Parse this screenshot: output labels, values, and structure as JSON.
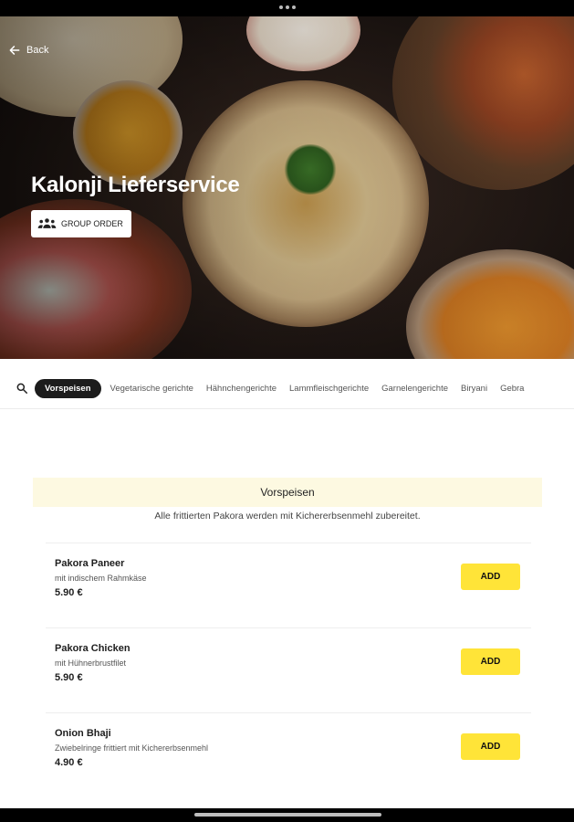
{
  "header": {
    "back_label": "Back"
  },
  "restaurant": {
    "name": "Kalonji Lieferservice",
    "group_order_label": "GROUP ORDER"
  },
  "categories": [
    {
      "label": "Vorspeisen",
      "active": true
    },
    {
      "label": "Vegetarische gerichte"
    },
    {
      "label": "Hähnchengerichte"
    },
    {
      "label": "Lammfleischgerichte"
    },
    {
      "label": "Garnelengerichte"
    },
    {
      "label": "Biryani"
    },
    {
      "label": "Gebra"
    }
  ],
  "section": {
    "title": "Vorspeisen",
    "description": "Alle frittierten Pakora werden mit Kichererbsenmehl zubereitet."
  },
  "items": [
    {
      "name": "Pakora Paneer",
      "description": "mit indischem Rahmkäse",
      "price": "5.90 €",
      "add_label": "ADD"
    },
    {
      "name": "Pakora Chicken",
      "description": "mit Hühnerbrustfilet",
      "price": "5.90 €",
      "add_label": "ADD"
    },
    {
      "name": "Onion Bhaji",
      "description": "Zwiebelringe frittiert mit Kichererbsenmehl",
      "price": "4.90 €",
      "add_label": "ADD"
    }
  ],
  "colors": {
    "accent": "#ffe438",
    "section_bg": "#fdf9e1",
    "active_chip": "#1c1c1c"
  },
  "icons": [
    "arrow-left-icon",
    "group-icon",
    "search-icon"
  ]
}
